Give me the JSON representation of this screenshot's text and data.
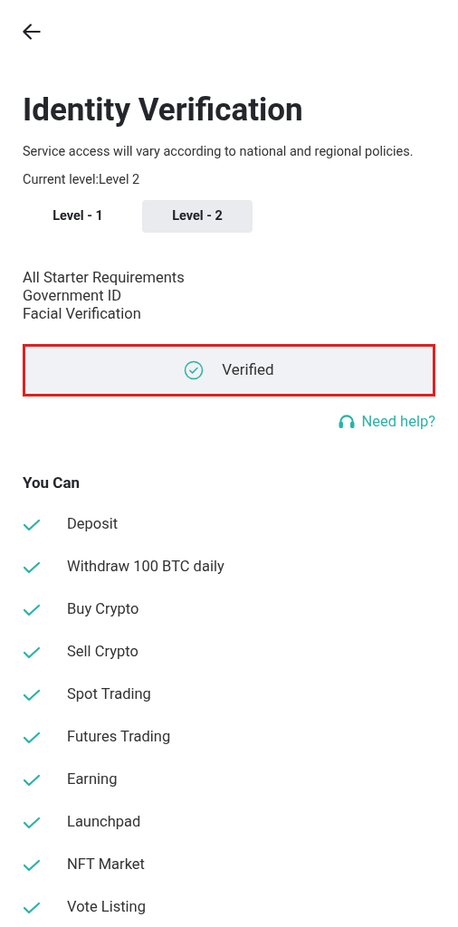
{
  "header": {
    "title": "Identity Verification",
    "subtitle": "Service access will vary according to national and regional policies.",
    "current_level": "Current level:Level 2"
  },
  "tabs": [
    {
      "label": "Level - 1",
      "selected": false
    },
    {
      "label": "Level - 2",
      "selected": true
    }
  ],
  "requirements": [
    "All Starter Requirements",
    "Government ID",
    "Facial Verification"
  ],
  "status": {
    "label": "Verified",
    "highlighted": true
  },
  "help_link": "Need help?",
  "permissions": {
    "title": "You Can",
    "items": [
      {
        "label": "Deposit",
        "checked": true
      },
      {
        "label": "Withdraw 100 BTC daily",
        "checked": true
      },
      {
        "label": "Buy Crypto",
        "checked": true
      },
      {
        "label": "Sell Crypto",
        "checked": true
      },
      {
        "label": "Spot Trading",
        "checked": true
      },
      {
        "label": "Futures Trading",
        "checked": true
      },
      {
        "label": "Earning",
        "checked": true
      },
      {
        "label": "Launchpad",
        "checked": true
      },
      {
        "label": "NFT Market",
        "checked": true
      },
      {
        "label": "Vote Listing",
        "checked": true
      }
    ]
  }
}
